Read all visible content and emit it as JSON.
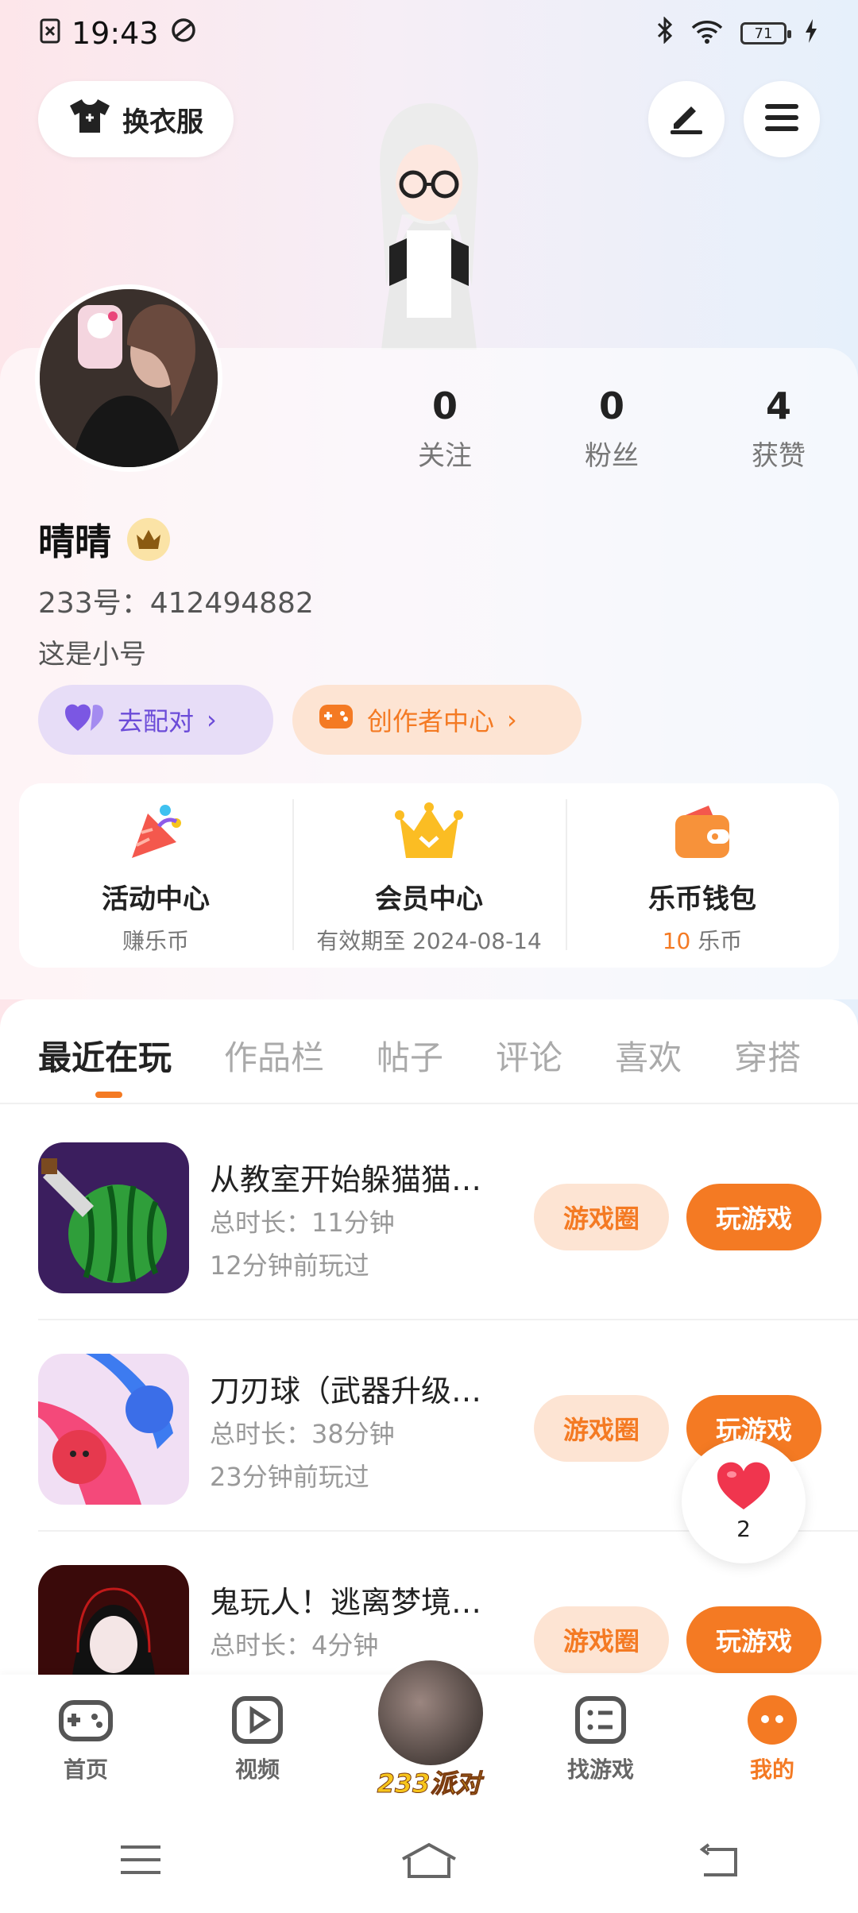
{
  "status_bar": {
    "time": "19:43",
    "battery": "71"
  },
  "top": {
    "dress_label": "换衣服"
  },
  "profile": {
    "stats": [
      {
        "value": "0",
        "label": "关注"
      },
      {
        "value": "0",
        "label": "粉丝"
      },
      {
        "value": "4",
        "label": "获赞"
      }
    ],
    "name": "晴晴",
    "uid": "233号：412494882",
    "bio": "这是小号",
    "match_label": "去配对",
    "creator_label": "创作者中心"
  },
  "cards": [
    {
      "title": "活动中心",
      "sub": "赚乐币"
    },
    {
      "title": "会员中心",
      "sub": "有效期至 2024-08-14"
    },
    {
      "title": "乐币钱包",
      "sub_value": "10",
      "sub_unit": " 乐币"
    }
  ],
  "tabs": [
    "最近在玩",
    "作品栏",
    "帖子",
    "评论",
    "喜欢",
    "穿搭"
  ],
  "games": [
    {
      "title": "从教室开始躲猫猫…",
      "duration": "总时长：11分钟",
      "last": "12分钟前玩过",
      "circle": "游戏圈",
      "play": "玩游戏"
    },
    {
      "title": "刀刃球（武器升级…",
      "duration": "总时长：38分钟",
      "last": "23分钟前玩过",
      "circle": "游戏圈",
      "play": "玩游戏"
    },
    {
      "title": "鬼玩人！逃离梦境…",
      "duration": "总时长：4分钟",
      "last": "",
      "circle": "游戏圈",
      "play": "玩游戏"
    }
  ],
  "like_count": "2",
  "nav": {
    "home": "首页",
    "video": "视频",
    "party": "233派对",
    "find": "找游戏",
    "mine": "我的"
  },
  "colors": {
    "accent": "#f47a23",
    "purple": "#6b4bd8"
  }
}
